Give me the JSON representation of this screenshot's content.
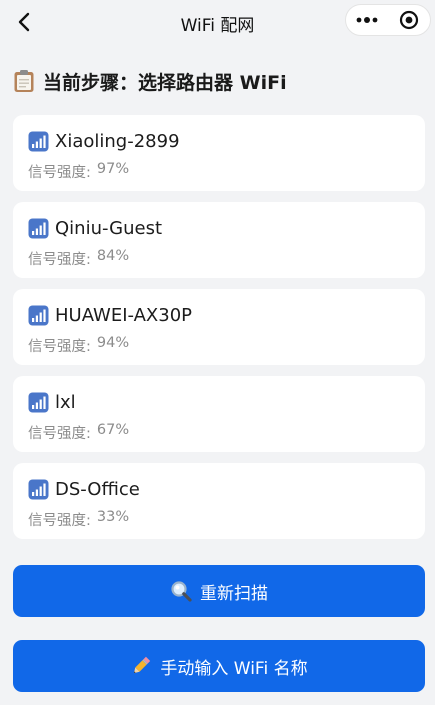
{
  "nav": {
    "title": "WiFi 配网",
    "back_icon": "chevron-left-icon",
    "more_icon": "more-dots-icon",
    "close_icon": "target-close-icon"
  },
  "step": {
    "icon": "clipboard-icon",
    "title": "当前步骤：选择路由器 WiFi"
  },
  "strength_label": "信号强度:",
  "networks": [
    {
      "ssid": "Xiaoling-2899",
      "strength": "97%"
    },
    {
      "ssid": "Qiniu-Guest",
      "strength": "84%"
    },
    {
      "ssid": "HUAWEI-AX30P",
      "strength": "94%"
    },
    {
      "ssid": "lxl",
      "strength": "67%"
    },
    {
      "ssid": "DS-Office",
      "strength": "33%"
    }
  ],
  "buttons": {
    "rescan": {
      "icon": "magnifier-icon",
      "label": "重新扫描"
    },
    "manual": {
      "icon": "pencil-icon",
      "label": "手动输入 WiFi 名称"
    }
  },
  "colors": {
    "primary": "#1168e8",
    "background": "#f2f3f5",
    "card": "#ffffff",
    "muted_text": "#8c8c8c",
    "signal_icon": "#4a76c9"
  }
}
